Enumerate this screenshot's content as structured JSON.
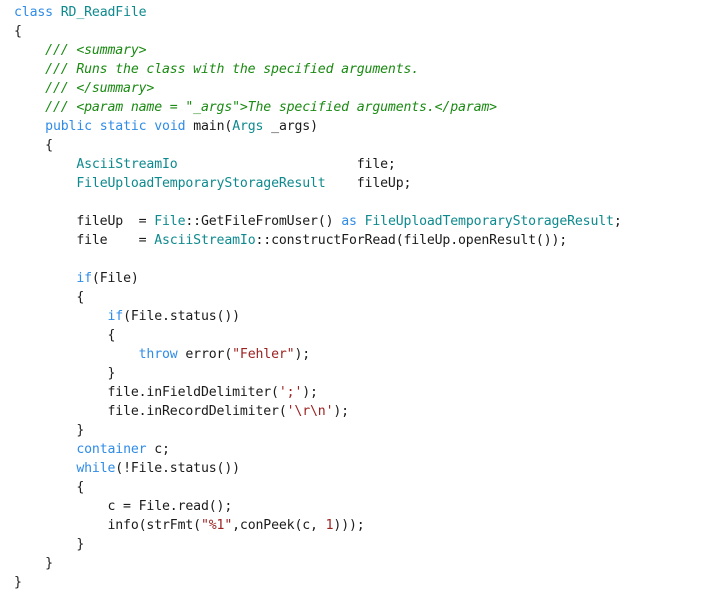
{
  "editor": {
    "language": "X++",
    "colors": {
      "background": "#ffffff",
      "plain": "#1b1b1b",
      "keyword": "#2f8ce6",
      "type": "#0e8a8e",
      "comment": "#1a8a12",
      "string": "#9c2222",
      "number": "#9c2222"
    },
    "lines": [
      {
        "tokens": [
          {
            "t": "keyword",
            "v": "class"
          },
          {
            "t": "plain",
            "v": " "
          },
          {
            "t": "type",
            "v": "RD_ReadFile"
          }
        ]
      },
      {
        "tokens": [
          {
            "t": "plain",
            "v": "{"
          }
        ]
      },
      {
        "tokens": [
          {
            "t": "comment",
            "v": "    /// <summary>"
          }
        ]
      },
      {
        "tokens": [
          {
            "t": "comment",
            "v": "    /// Runs the class with the specified arguments."
          }
        ]
      },
      {
        "tokens": [
          {
            "t": "comment",
            "v": "    /// </summary>"
          }
        ]
      },
      {
        "tokens": [
          {
            "t": "comment",
            "v": "    /// <param name = \"_args\">The specified arguments.</param>"
          }
        ]
      },
      {
        "tokens": [
          {
            "t": "plain",
            "v": "    "
          },
          {
            "t": "keyword",
            "v": "public"
          },
          {
            "t": "plain",
            "v": " "
          },
          {
            "t": "keyword",
            "v": "static"
          },
          {
            "t": "plain",
            "v": " "
          },
          {
            "t": "keyword",
            "v": "void"
          },
          {
            "t": "plain",
            "v": " main("
          },
          {
            "t": "type",
            "v": "Args"
          },
          {
            "t": "plain",
            "v": " _args)"
          }
        ]
      },
      {
        "tokens": [
          {
            "t": "plain",
            "v": "    {"
          }
        ]
      },
      {
        "tokens": [
          {
            "t": "plain",
            "v": "        "
          },
          {
            "t": "type",
            "v": "AsciiStreamIo"
          },
          {
            "t": "plain",
            "v": "                       file;"
          }
        ]
      },
      {
        "tokens": [
          {
            "t": "plain",
            "v": "        "
          },
          {
            "t": "type",
            "v": "FileUploadTemporaryStorageResult"
          },
          {
            "t": "plain",
            "v": "    fileUp;"
          }
        ]
      },
      {
        "tokens": [
          {
            "t": "plain",
            "v": ""
          }
        ]
      },
      {
        "tokens": [
          {
            "t": "plain",
            "v": "        fileUp  = "
          },
          {
            "t": "type",
            "v": "File"
          },
          {
            "t": "plain",
            "v": "::GetFileFromUser() "
          },
          {
            "t": "keyword",
            "v": "as"
          },
          {
            "t": "plain",
            "v": " "
          },
          {
            "t": "type",
            "v": "FileUploadTemporaryStorageResult"
          },
          {
            "t": "plain",
            "v": ";"
          }
        ]
      },
      {
        "tokens": [
          {
            "t": "plain",
            "v": "        file    = "
          },
          {
            "t": "type",
            "v": "AsciiStreamIo"
          },
          {
            "t": "plain",
            "v": "::constructForRead(fileUp.openResult());"
          }
        ]
      },
      {
        "tokens": [
          {
            "t": "plain",
            "v": ""
          }
        ]
      },
      {
        "tokens": [
          {
            "t": "plain",
            "v": "        "
          },
          {
            "t": "keyword",
            "v": "if"
          },
          {
            "t": "plain",
            "v": "(File)"
          }
        ]
      },
      {
        "tokens": [
          {
            "t": "plain",
            "v": "        {"
          }
        ]
      },
      {
        "tokens": [
          {
            "t": "plain",
            "v": "            "
          },
          {
            "t": "keyword",
            "v": "if"
          },
          {
            "t": "plain",
            "v": "(File.status())"
          }
        ]
      },
      {
        "tokens": [
          {
            "t": "plain",
            "v": "            {"
          }
        ]
      },
      {
        "tokens": [
          {
            "t": "plain",
            "v": "                "
          },
          {
            "t": "keyword",
            "v": "throw"
          },
          {
            "t": "plain",
            "v": " error("
          },
          {
            "t": "string",
            "v": "\"Fehler\""
          },
          {
            "t": "plain",
            "v": ");"
          }
        ]
      },
      {
        "tokens": [
          {
            "t": "plain",
            "v": "            }"
          }
        ]
      },
      {
        "tokens": [
          {
            "t": "plain",
            "v": "            file.inFieldDelimiter("
          },
          {
            "t": "string",
            "v": "';'"
          },
          {
            "t": "plain",
            "v": ");"
          }
        ]
      },
      {
        "tokens": [
          {
            "t": "plain",
            "v": "            file.inRecordDelimiter("
          },
          {
            "t": "string",
            "v": "'\\r\\n'"
          },
          {
            "t": "plain",
            "v": ");"
          }
        ]
      },
      {
        "tokens": [
          {
            "t": "plain",
            "v": "        }"
          }
        ]
      },
      {
        "tokens": [
          {
            "t": "plain",
            "v": "        "
          },
          {
            "t": "keyword",
            "v": "container"
          },
          {
            "t": "plain",
            "v": " c;"
          }
        ]
      },
      {
        "tokens": [
          {
            "t": "plain",
            "v": "        "
          },
          {
            "t": "keyword",
            "v": "while"
          },
          {
            "t": "plain",
            "v": "(!File.status())"
          }
        ]
      },
      {
        "tokens": [
          {
            "t": "plain",
            "v": "        {"
          }
        ]
      },
      {
        "tokens": [
          {
            "t": "plain",
            "v": "            c = File.read();"
          }
        ]
      },
      {
        "tokens": [
          {
            "t": "plain",
            "v": "            info(strFmt("
          },
          {
            "t": "string",
            "v": "\"%1\""
          },
          {
            "t": "plain",
            "v": ",conPeek(c, "
          },
          {
            "t": "number",
            "v": "1"
          },
          {
            "t": "plain",
            "v": ")));"
          }
        ]
      },
      {
        "tokens": [
          {
            "t": "plain",
            "v": "        }"
          }
        ]
      },
      {
        "tokens": [
          {
            "t": "plain",
            "v": "    }"
          }
        ]
      },
      {
        "tokens": [
          {
            "t": "plain",
            "v": "}"
          }
        ]
      }
    ]
  }
}
